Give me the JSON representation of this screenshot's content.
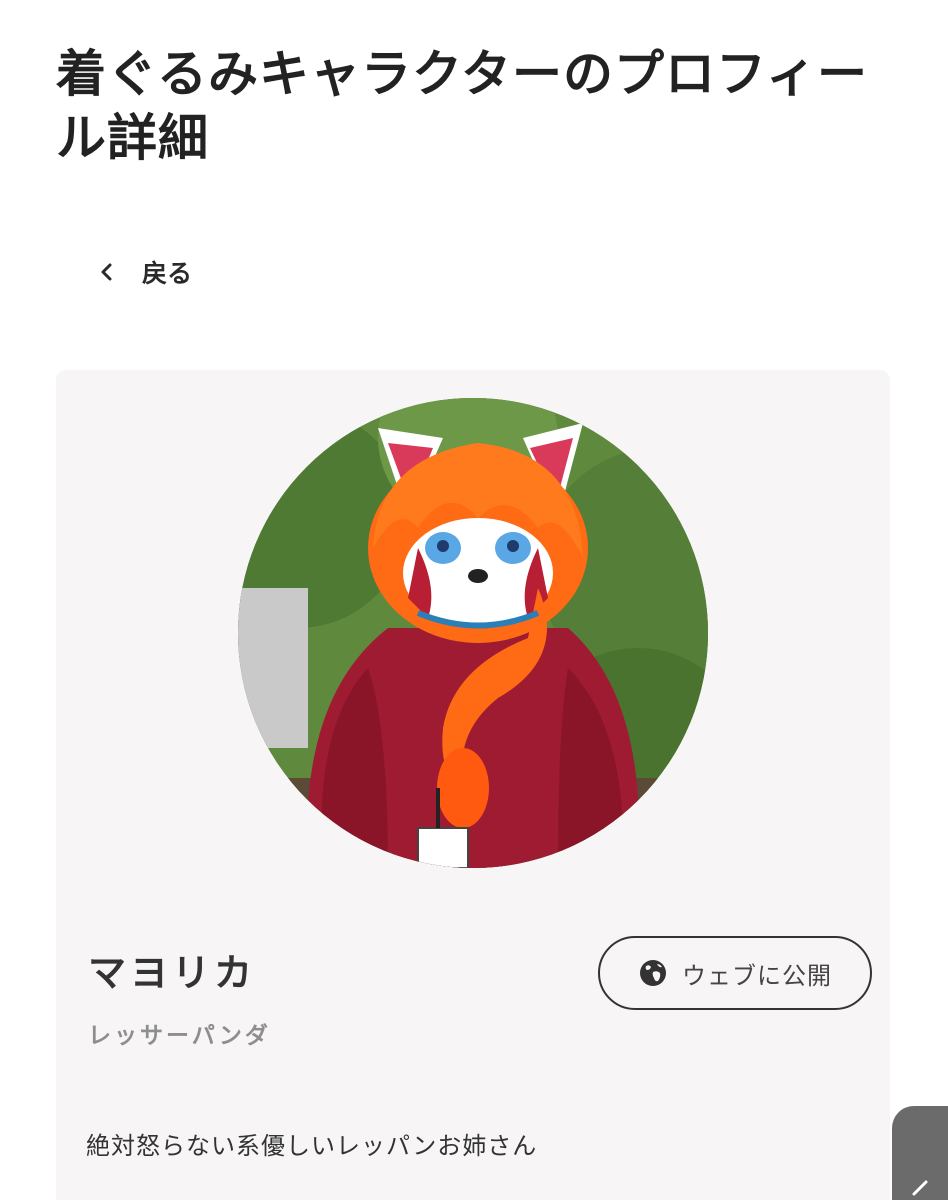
{
  "page": {
    "title": "着ぐるみキャラクターのプロフィール詳細"
  },
  "navigation": {
    "back_label": "戻る",
    "back_icon": "chevron-left-icon"
  },
  "profile": {
    "name": "マヨリカ",
    "species": "レッサーパンダ",
    "bio": "絶対怒らない系優しいレッパンお姉さん",
    "avatar": "red-panda-fursuit-photo",
    "publish_button": {
      "label": "ウェブに公開",
      "icon": "globe-icon"
    }
  },
  "colors": {
    "card_background": "#f7f5f6",
    "title_text": "#222222",
    "muted_text": "#8e8e8e",
    "button_border": "#333333"
  }
}
